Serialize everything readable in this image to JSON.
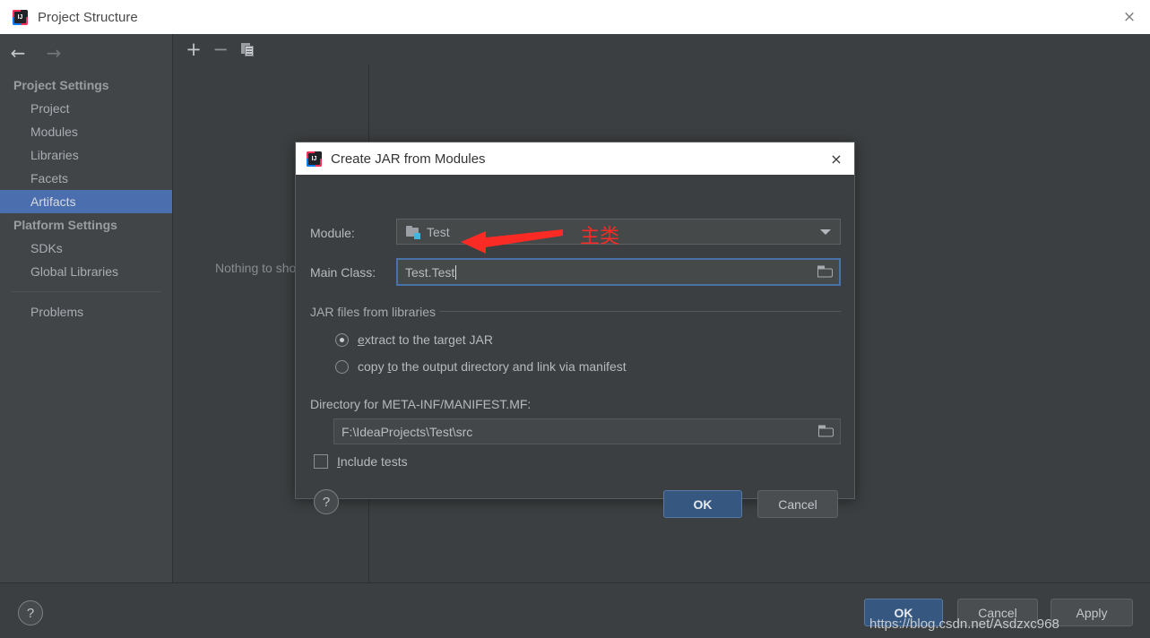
{
  "window": {
    "title": "Project Structure",
    "logo_text": "IJ",
    "close_icon": "×"
  },
  "nav": {
    "back_icon": "←",
    "forward_icon": "→"
  },
  "sidebar": {
    "groups": [
      {
        "label": "Project Settings",
        "items": [
          {
            "label": "Project",
            "selected": false
          },
          {
            "label": "Modules",
            "selected": false
          },
          {
            "label": "Libraries",
            "selected": false
          },
          {
            "label": "Facets",
            "selected": false
          },
          {
            "label": "Artifacts",
            "selected": true
          }
        ]
      },
      {
        "label": "Platform Settings",
        "items": [
          {
            "label": "SDKs",
            "selected": false
          },
          {
            "label": "Global Libraries",
            "selected": false
          }
        ]
      }
    ],
    "problems_label": "Problems",
    "selected_color": "#4b6eaf"
  },
  "toolbar": {
    "add_icon": "+",
    "remove_icon": "−",
    "copy_icon": "copy-icon"
  },
  "artifacts_panel": {
    "empty_text": "Nothing to show"
  },
  "bottom_bar": {
    "help_label": "?",
    "ok_label": "OK",
    "cancel_label": "Cancel",
    "apply_label": "Apply",
    "ok_color": "#365880"
  },
  "watermark": {
    "text": "https://blog.csdn.net/Asdzxc968"
  },
  "dialog": {
    "title": "Create JAR from Modules",
    "close_icon": "×",
    "module": {
      "label": "Module:",
      "value": "Test",
      "icon": "module-folder-icon",
      "dropdown_icon": "chevron-down-icon"
    },
    "main_class": {
      "label": "Main Class:",
      "value": "Test.Test",
      "browse_icon": "folder-icon",
      "focused": true
    },
    "annotation": {
      "text": "主类",
      "color": "#fa2a24",
      "arrow": "left-arrow"
    },
    "jar_files_group": {
      "title": "JAR files from libraries",
      "options": [
        {
          "label_prefix": "",
          "mnemonic": "e",
          "label_suffix": "xtract to the target JAR",
          "selected": true
        },
        {
          "label_prefix": "copy ",
          "mnemonic": "t",
          "label_suffix": "o the output directory and link via manifest",
          "selected": false
        }
      ]
    },
    "manifest": {
      "label": "Directory for META-INF/MANIFEST.MF:",
      "value": "F:\\IdeaProjects\\Test\\src",
      "browse_icon": "folder-icon"
    },
    "include_tests": {
      "label_mnemonic": "I",
      "label_rest": "nclude tests",
      "checked": false
    },
    "help_label": "?",
    "ok_label": "OK",
    "cancel_label": "Cancel"
  }
}
